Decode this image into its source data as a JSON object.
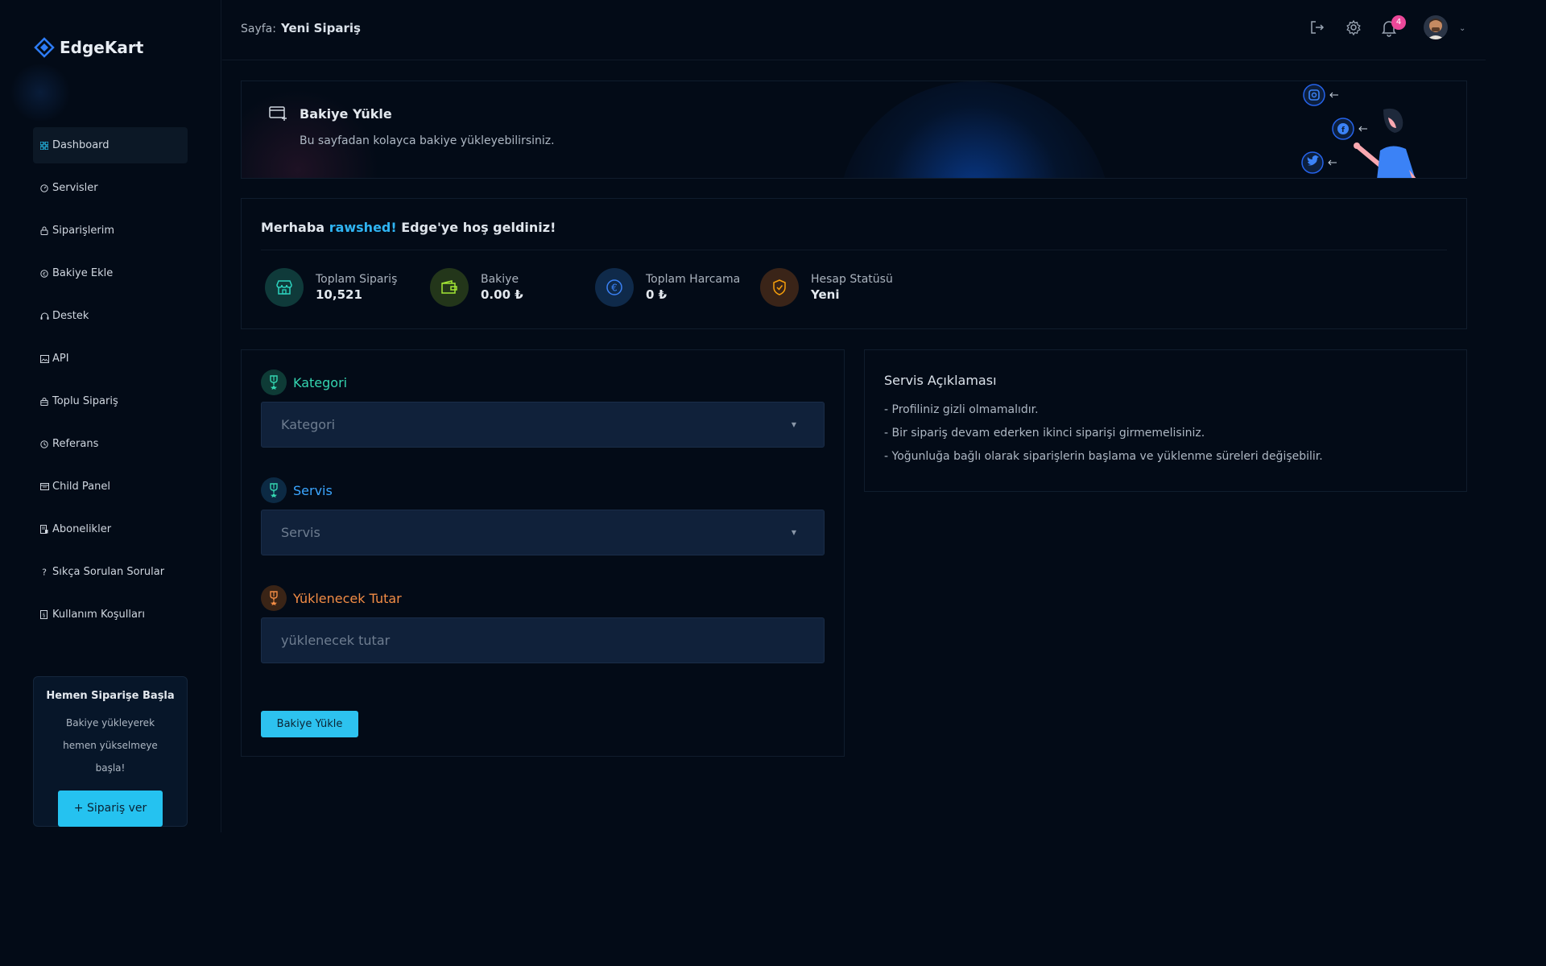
{
  "app": {
    "logo_text": "EdgeKart",
    "accent": "#25c2f0",
    "background": "#030b17"
  },
  "sidebar": {
    "items": [
      {
        "label": "Dashboard",
        "icon": "grid-icon",
        "active": true
      },
      {
        "label": "Servisler",
        "icon": "speedometer-icon"
      },
      {
        "label": "Siparişlerim",
        "icon": "lock-icon"
      },
      {
        "label": "Bakiye Ekle",
        "icon": "euro-icon"
      },
      {
        "label": "Destek",
        "icon": "headset-icon"
      },
      {
        "label": "API",
        "icon": "image-icon"
      },
      {
        "label": "Toplu Sipariş",
        "icon": "bag-icon"
      },
      {
        "label": "Referans",
        "icon": "clock-icon"
      },
      {
        "label": "Child Panel",
        "icon": "panel-icon"
      },
      {
        "label": "Abonelikler",
        "icon": "document-icon"
      },
      {
        "label": "Sıkça Sorulan Sorular",
        "icon": "question-icon"
      },
      {
        "label": "Kullanım Koşulları",
        "icon": "terms-icon"
      }
    ],
    "promo": {
      "title": "Hemen Siparişe Başla",
      "description": "Bakiye yükleyerek hemen yükselmeye başla!",
      "button": "+ Sipariş ver"
    }
  },
  "topbar": {
    "page_prefix": "Sayfa:",
    "page_name": "Yeni Sipariş",
    "notification_count": "4"
  },
  "banner": {
    "title": "Bakiye Yükle",
    "subtitle": "Bu sayfadan kolayca bakiye yükleyebilirsiniz."
  },
  "welcome": {
    "greeting": "Merhaba",
    "username": "rawshed!",
    "suffix": "Edge'ye hoş geldiniz!",
    "stats": [
      {
        "label": "Toplam Sipariş",
        "value": "10,521",
        "icon": "store-icon",
        "color": "#2dd4bf"
      },
      {
        "label": "Bakiye",
        "value": "0.00 ₺",
        "icon": "wallet-icon",
        "color": "#a3e635"
      },
      {
        "label": "Toplam Harcama",
        "value": "0 ₺",
        "icon": "euro-icon",
        "color": "#3b82f6"
      },
      {
        "label": "Hesap Statüsü",
        "value": "Yeni",
        "icon": "shield-icon",
        "color": "#f59e0b"
      }
    ]
  },
  "form": {
    "category": {
      "label": "Kategori",
      "placeholder": "Kategori",
      "color": "#34d5b0"
    },
    "service": {
      "label": "Servis",
      "placeholder": "Servis",
      "color": "#3ba6ff"
    },
    "amount": {
      "label": "Yüklenecek Tutar",
      "placeholder": "yüklenecek tutar",
      "color": "#f28c45"
    },
    "submit": "Bakiye Yükle"
  },
  "description": {
    "title": "Servis Açıklaması",
    "lines": [
      "- Profiliniz gizli olmamalıdır.",
      "- Bir sipariş devam ederken ikinci siparişi girmemelisiniz.",
      "- Yoğunluğa bağlı olarak siparişlerin başlama ve yüklenme süreleri değişebilir."
    ]
  }
}
